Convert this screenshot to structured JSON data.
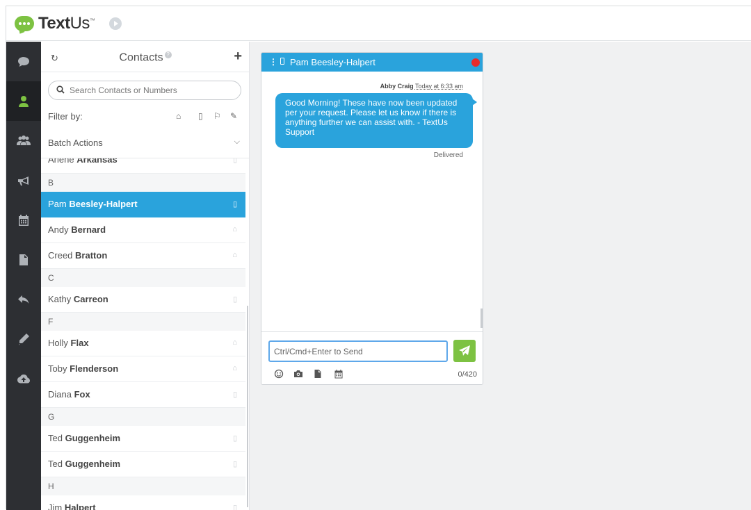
{
  "brand": {
    "name_bold": "Text",
    "name_rest": "Us",
    "trademark": "™",
    "accent": "#7dc242",
    "primary": "#2aa3dc"
  },
  "rail": {
    "items": [
      {
        "icon": "chat-icon",
        "active": false
      },
      {
        "icon": "user-icon",
        "active": true
      },
      {
        "icon": "group-icon",
        "active": false
      },
      {
        "icon": "megaphone-icon",
        "active": false
      },
      {
        "icon": "calendar-icon",
        "active": false
      },
      {
        "icon": "document-icon",
        "active": false
      },
      {
        "icon": "reply-icon",
        "active": false
      },
      {
        "icon": "pencil-icon",
        "active": false
      },
      {
        "icon": "cloud-upload-icon",
        "active": false
      }
    ]
  },
  "contacts": {
    "title": "Contacts",
    "help_glyph": "?",
    "search_placeholder": "Search Contacts or Numbers",
    "filter_label": "Filter by:",
    "batch_label": "Batch Actions",
    "rows": [
      {
        "type": "contact",
        "first": "Arlene",
        "last": "Arkansas",
        "icon": "mobile-icon",
        "selected": false
      },
      {
        "type": "section",
        "label": "B"
      },
      {
        "type": "contact",
        "first": "Pam",
        "last": "Beesley-Halpert",
        "icon": "mobile-icon",
        "selected": true
      },
      {
        "type": "contact",
        "first": "Andy",
        "last": "Bernard",
        "icon": "home-icon",
        "selected": false
      },
      {
        "type": "contact",
        "first": "Creed",
        "last": "Bratton",
        "icon": "home-icon",
        "selected": false
      },
      {
        "type": "section",
        "label": "C"
      },
      {
        "type": "contact",
        "first": "Kathy",
        "last": "Carreon",
        "icon": "mobile-icon",
        "selected": false
      },
      {
        "type": "section",
        "label": "F"
      },
      {
        "type": "contact",
        "first": "Holly",
        "last": "Flax",
        "icon": "home-icon",
        "selected": false
      },
      {
        "type": "contact",
        "first": "Toby",
        "last": "Flenderson",
        "icon": "home-icon",
        "selected": false
      },
      {
        "type": "contact",
        "first": "Diana",
        "last": "Fox",
        "icon": "mobile-icon",
        "selected": false
      },
      {
        "type": "section",
        "label": "G"
      },
      {
        "type": "contact",
        "first": "Ted",
        "last": "Guggenheim",
        "icon": "mobile-icon",
        "selected": false
      },
      {
        "type": "contact",
        "first": "Ted",
        "last": "Guggenheim",
        "icon": "mobile-icon",
        "selected": false
      },
      {
        "type": "section",
        "label": "H"
      },
      {
        "type": "contact",
        "first": "Jim",
        "last": "Halpert",
        "icon": "mobile-icon",
        "selected": false
      }
    ]
  },
  "conversation": {
    "title": "Pam Beesley-Halpert",
    "sender": "Abby Craig",
    "timestamp": "Today at 6:33 am",
    "message": "Good Morning! These have now been updated per your request. Please let us know if there is anything further we can assist with. - TextUs Support",
    "status": "Delivered",
    "compose_placeholder": "Ctrl/Cmd+Enter to Send",
    "char_count": "0/420"
  }
}
